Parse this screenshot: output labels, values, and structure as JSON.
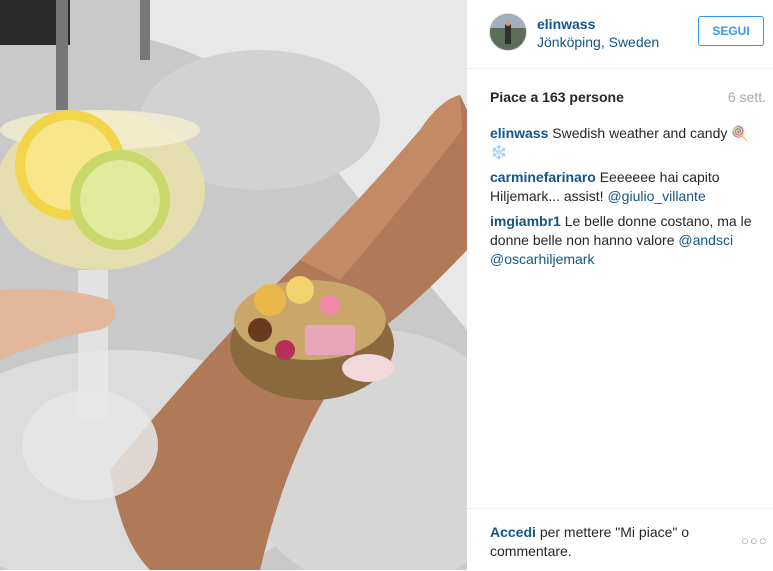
{
  "post": {
    "username": "elinwass",
    "location": "Jönköping, Sweden",
    "follow_label": "SEGUI"
  },
  "stats": {
    "likes": "Piace a 163 persone",
    "time": "6 sett."
  },
  "comments": [
    {
      "user": "elinwass",
      "text": "Swedish weather and candy 🍭❄️",
      "mentions": []
    },
    {
      "user": "carminefarinaro",
      "text": "Eeeeeee hai capito Hiljemark... assist!",
      "mentions": [
        "@giulio_villante"
      ]
    },
    {
      "user": "imgiambr1",
      "text": "Le belle donne costano, ma le donne belle non hanno valore",
      "mentions": [
        "@andsci",
        "@oscarhiljemark"
      ]
    }
  ],
  "footer": {
    "login_link": "Accedi",
    "login_text": "per mettere \"Mi piace\" o commentare.",
    "more": "○○○"
  },
  "colors": {
    "link": "#125688",
    "follow": "#3897f0",
    "muted": "#a5a7aa"
  }
}
